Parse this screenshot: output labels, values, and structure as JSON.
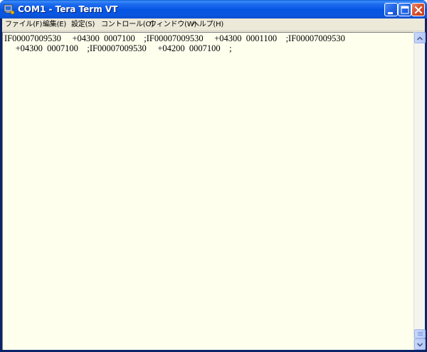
{
  "window": {
    "title": "COM1 - Tera Term VT",
    "icon": "tera-term-app-icon",
    "controls": {
      "minimize": "minimize-icon",
      "maximize": "maximize-icon",
      "close": "close-icon"
    }
  },
  "menubar": {
    "items": [
      {
        "label": "ファイル(F)"
      },
      {
        "label": "編集(E)"
      },
      {
        "label": "設定(S)"
      },
      {
        "label": "コントロール(O)"
      },
      {
        "label": "ウィンドウ(W)"
      },
      {
        "label": "ヘルプ(H)"
      }
    ]
  },
  "terminal": {
    "lines": [
      "IF00007009530     +04300  0007100    ;IF00007009530     +04300  0001100    ;IF00007009530",
      "     +04300  0007100    ;IF00007009530     +04200  0007100    ;"
    ]
  },
  "colors": {
    "terminal_background": "#ffffee",
    "terminal_text": "#000000",
    "titlebar": "#0554e2",
    "frame": "#ece9d8"
  }
}
